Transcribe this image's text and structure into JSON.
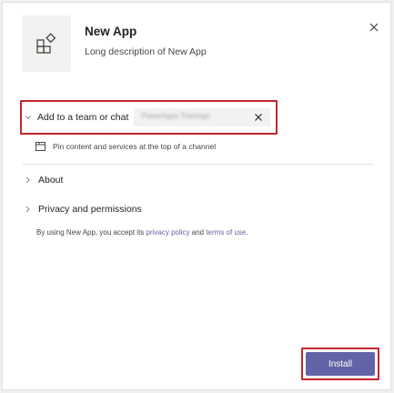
{
  "app": {
    "name": "New App",
    "description": "Long description of New App",
    "icon": "apps-icon"
  },
  "add_to": {
    "label": "Add to a team or chat",
    "selected_team": "PowerApps Trainings",
    "hint": "Pin content and services at the top of a channel"
  },
  "sections": {
    "about": "About",
    "privacy": "Privacy and permissions"
  },
  "legal": {
    "prefix": "By using New App, you accept its ",
    "privacy_link": "privacy policy",
    "and": " and ",
    "terms_link": "terms of use",
    "suffix": "."
  },
  "actions": {
    "install": "Install"
  },
  "colors": {
    "accent": "#6264a7",
    "highlight": "#c4262e"
  }
}
